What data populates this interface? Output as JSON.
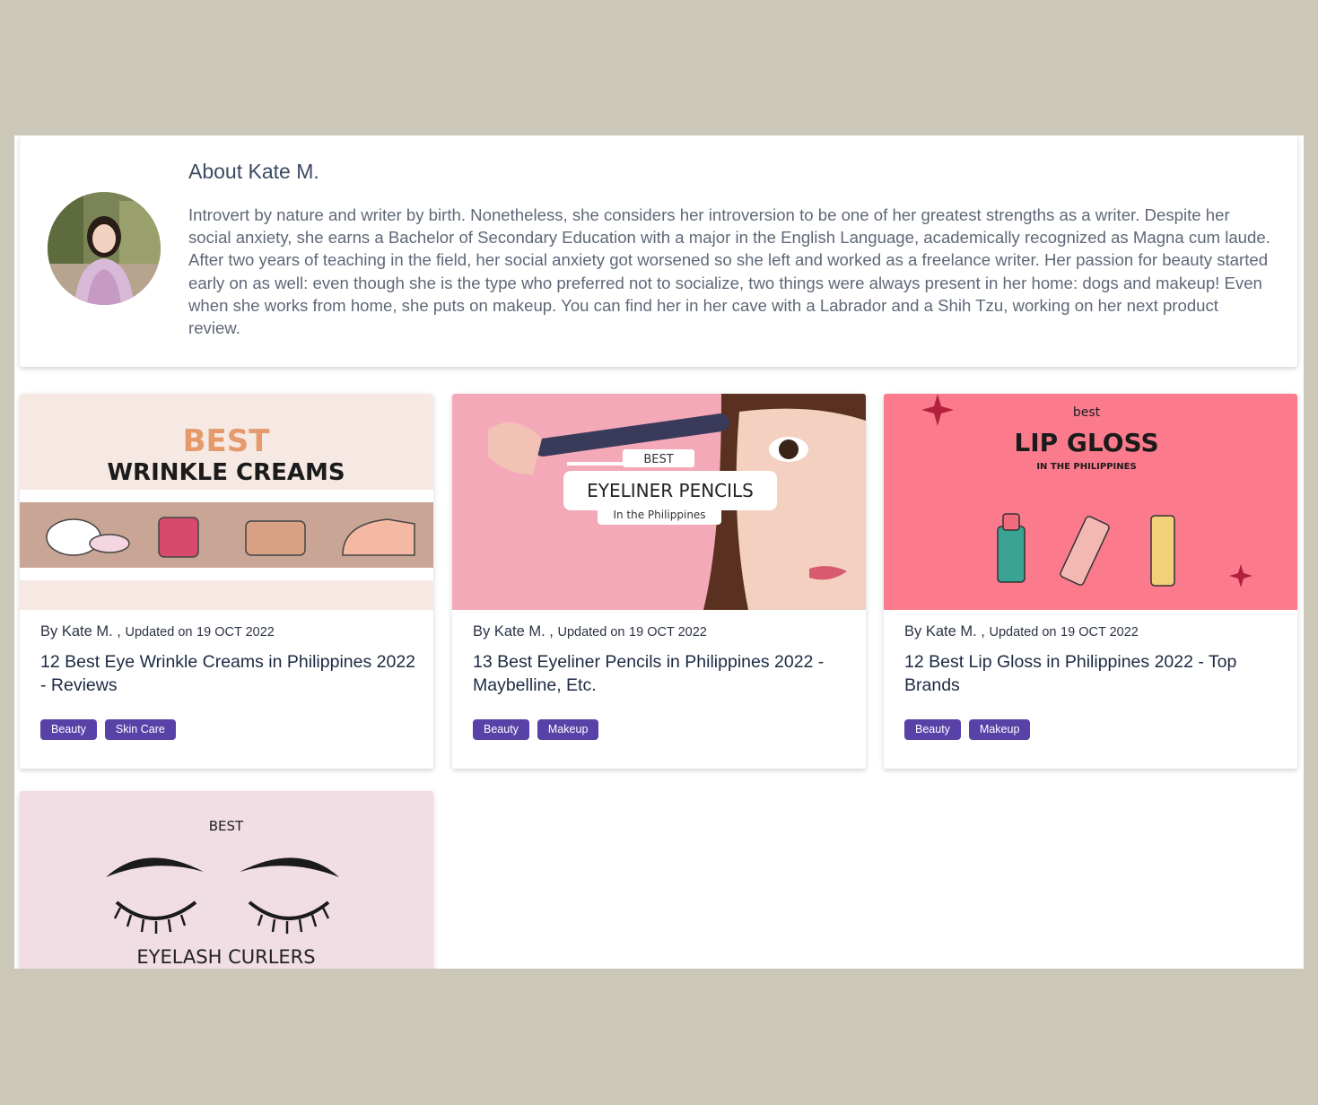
{
  "about": {
    "title": "About Kate M.",
    "bio": "Introvert by nature and writer by birth. Nonetheless, she considers her introversion to be one of her greatest strengths as a writer. Despite her social anxiety, she earns a Bachelor of Secondary Education with a major in the English Language, academically recognized as Magna cum laude. After two years of teaching in the field, her social anxiety got worsened so she left and worked as a freelance writer. Her passion for beauty started early on as well: even though she is the type who preferred not to socialize, two things were always present in her home: dogs and makeup! Even when she works from home, she puts on makeup. You can find her in her cave with a Labrador and a Shih Tzu, working on her next product review."
  },
  "cards": [
    {
      "thumb": {
        "line1": "BEST",
        "line2": "WRINKLE CREAMS"
      },
      "author": "By Kate M. ,",
      "updated_label": "Updated on",
      "date": "19 OCT 2022",
      "title": "12 Best Eye Wrinkle Creams in Philippines 2022 - Reviews",
      "tags": [
        "Beauty",
        "Skin Care"
      ]
    },
    {
      "thumb": {
        "line1": "BEST",
        "line2": "EYELINER PENCILS",
        "line3": "In the Philippines"
      },
      "author": "By Kate M. ,",
      "updated_label": "Updated on",
      "date": "19 OCT 2022",
      "title": "13 Best Eyeliner Pencils in Philippines 2022 - Maybelline, Etc.",
      "tags": [
        "Beauty",
        "Makeup"
      ]
    },
    {
      "thumb": {
        "line1": "best",
        "line2": "LIP GLOSS",
        "line3": "IN THE PHILIPPINES"
      },
      "author": "By Kate M. ,",
      "updated_label": "Updated on",
      "date": "19 OCT 2022",
      "title": "12 Best Lip Gloss in Philippines 2022 - Top Brands",
      "tags": [
        "Beauty",
        "Makeup"
      ]
    },
    {
      "thumb": {
        "line1": "BEST",
        "line2": "EYELASH CURLERS"
      }
    }
  ],
  "colors": {
    "tag": "#5842a8",
    "background": "#cbc8b7"
  }
}
